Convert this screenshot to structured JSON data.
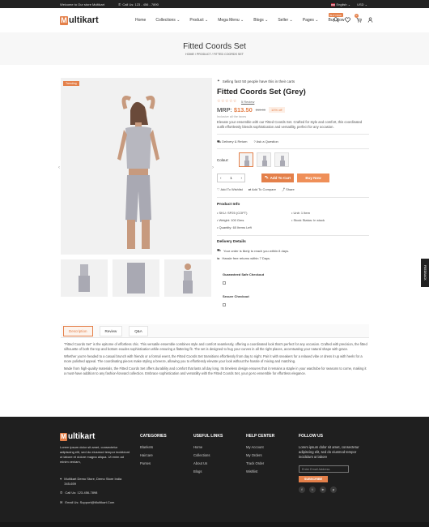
{
  "topbar": {
    "welcome": "Welcome to Our store Multikart",
    "call": "Call Us: 123 - 456 - 7890",
    "language": "English",
    "currency": "USD"
  },
  "header": {
    "logo_letter": "M",
    "logo_text": "ultikart",
    "nav": [
      "Home",
      "Collections",
      "Product",
      "Mega Menu",
      "Blogs",
      "Seller",
      "Pages",
      "Buy Now"
    ],
    "buy_badge": "BUY NOW",
    "cart_count": "0"
  },
  "page": {
    "title": "Fitted Coords Set",
    "breadcrumb": "HOME / PRODUCT / FITTED COORDS SET"
  },
  "gallery": {
    "tag": "Trending"
  },
  "product": {
    "selling": "Selling fast! 50 people have this in their carts",
    "title": "Fitted Coords Set (Grey)",
    "stars": "☆☆☆☆☆",
    "review": "5 Review",
    "mrp_label": "MRP:",
    "price": "$13.50",
    "old_price": "$15.00",
    "off": "10% off",
    "incl": "Inclusive all the taxes",
    "desc": "Elevate your ensemble with our Fitted Coords Set. Crafted for style and comfort, this coordinated outfit effortlessly blends sophistication and versatility, perfect for any occasion.",
    "delivery_return": "Delivery & Return",
    "ask_question": "Ask a Question",
    "colour_label": "Colour:",
    "qty": "1",
    "add_to_cart": "Add To Cart",
    "buy_now": "Buy Now",
    "wishlist": "Add To Wishlist",
    "compare": "Add To Compare",
    "share": "Share",
    "info_title": "Product Info",
    "info": [
      "SKU: SP25 (COFT)",
      "Unit: 1 Item",
      "Weight: 100 Gms",
      "Stock Status: In stock",
      "Quantity: 60 Items Left"
    ],
    "delivery_title": "Delivery Details",
    "delivery_lines": [
      "Your order is likely to reach you within 8 days.",
      "Hassle free returns within 7 Days."
    ],
    "guaranteed": "Guaranteed Safe Checkout",
    "secure": "Secure Checkout"
  },
  "feedback": "FEEDBACK",
  "tabs": [
    "Description",
    "Review",
    "Q&A"
  ],
  "description": [
    "\"Fitted Coords Set\" is the epitome of effortless chic. This versatile ensemble combines style and comfort seamlessly, offering a coordinated look that's perfect for any occasion. Crafted with precision, the fitted silhouette of both the top and bottom exudes sophistication while ensuring a flattering fit. The set is designed to hug your curves in all the right places, accentuating your natural shape with grace.",
    "Whether you're headed to a casual brunch with friends or a formal event, the Fitted Coords Set transitions effortlessly from day to night. Pair it with sneakers for a relaxed vibe or dress it up with heels for a more polished appeal. The coordinating pieces make styling a breeze, allowing you to effortlessly elevate your look without the hassle of mixing and matching.",
    "Made from high-quality materials, the Fitted Coords Set offers durability and comfort that lasts all day long. Its timeless design ensures that it remains a staple in your wardrobe for seasons to come, making it a must-have addition to any fashion-forward collection. Embrace sophistication and versatility with the Fitted Coords Set, your go-to ensemble for effortless elegance."
  ],
  "footer": {
    "logo_letter": "M",
    "logo_text": "ultikart",
    "about": "Lorem ipsum dolor sit amet, consectetur adipiscing elit, sed do eiusmod tempor incididunt ut labore et dolore magna aliqua. Ut enim ad minim veniam,",
    "address": "Multikart Demo Store, Demo Store India 345-659",
    "phone": "Call Us: 123-456-7898",
    "email": "Email Us: Support@Multikart.Com",
    "categories_title": "CATEGORIES",
    "categories": [
      "Blankets",
      "Haircare",
      "Purses"
    ],
    "useful_title": "USEFUL LINKS",
    "useful": [
      "Home",
      "Collections",
      "About Us",
      "Blogs"
    ],
    "help_title": "HELP CENTER",
    "help": [
      "My Account",
      "My Orders",
      "Track Order",
      "Wishlist"
    ],
    "follow_title": "FOLLOW US",
    "follow_text": "Lorem ipsum dolor sit amet, consectetur adipiscing elit, sed do eiusmod tempor incididunt ut labore",
    "email_placeholder": "Enter Email Address",
    "subscribe": "SUBSCRIBE",
    "social": [
      "f",
      "t",
      "in",
      "p"
    ]
  },
  "colors": {
    "accent": "#e4804a",
    "dark": "#222222",
    "footer": "#1f1f1f"
  }
}
